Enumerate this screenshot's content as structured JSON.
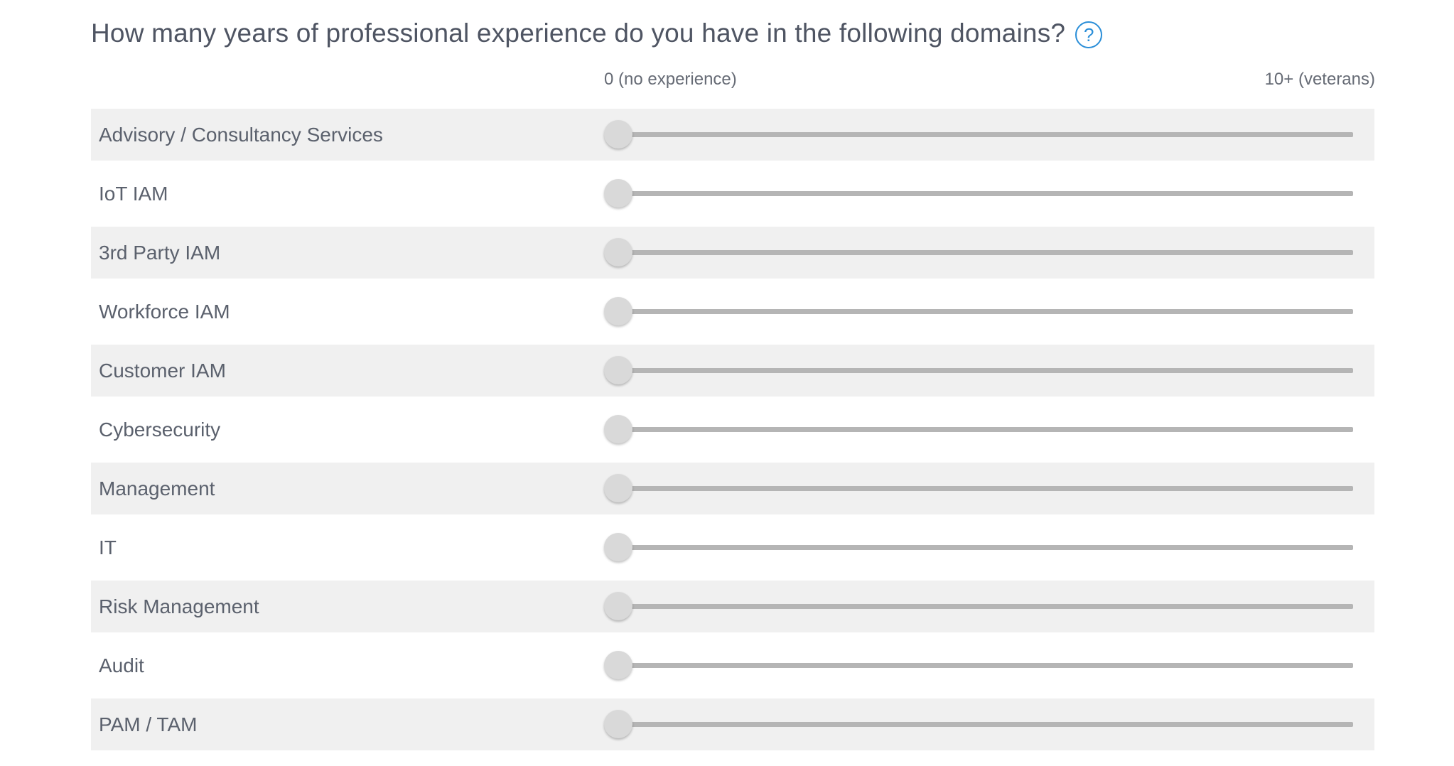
{
  "question": {
    "title": "How many years of professional experience do you have in the following domains?",
    "help_label": "?"
  },
  "scale": {
    "min_label": "0 (no experience)",
    "max_label": "10+ (veterans)"
  },
  "rows": [
    {
      "label": "Advisory / Consultancy Services",
      "value": 0
    },
    {
      "label": "IoT IAM",
      "value": 0
    },
    {
      "label": "3rd Party IAM",
      "value": 0
    },
    {
      "label": "Workforce IAM",
      "value": 0
    },
    {
      "label": "Customer IAM",
      "value": 0
    },
    {
      "label": "Cybersecurity",
      "value": 0
    },
    {
      "label": "Management",
      "value": 0
    },
    {
      "label": "IT",
      "value": 0
    },
    {
      "label": "Risk Management",
      "value": 0
    },
    {
      "label": "Audit",
      "value": 0
    },
    {
      "label": "PAM / TAM",
      "value": 0
    }
  ],
  "colors": {
    "accent": "#2a8ed8",
    "row_shade": "#f0f0f0",
    "track": "#b5b5b5",
    "thumb": "#d9d9d9"
  }
}
